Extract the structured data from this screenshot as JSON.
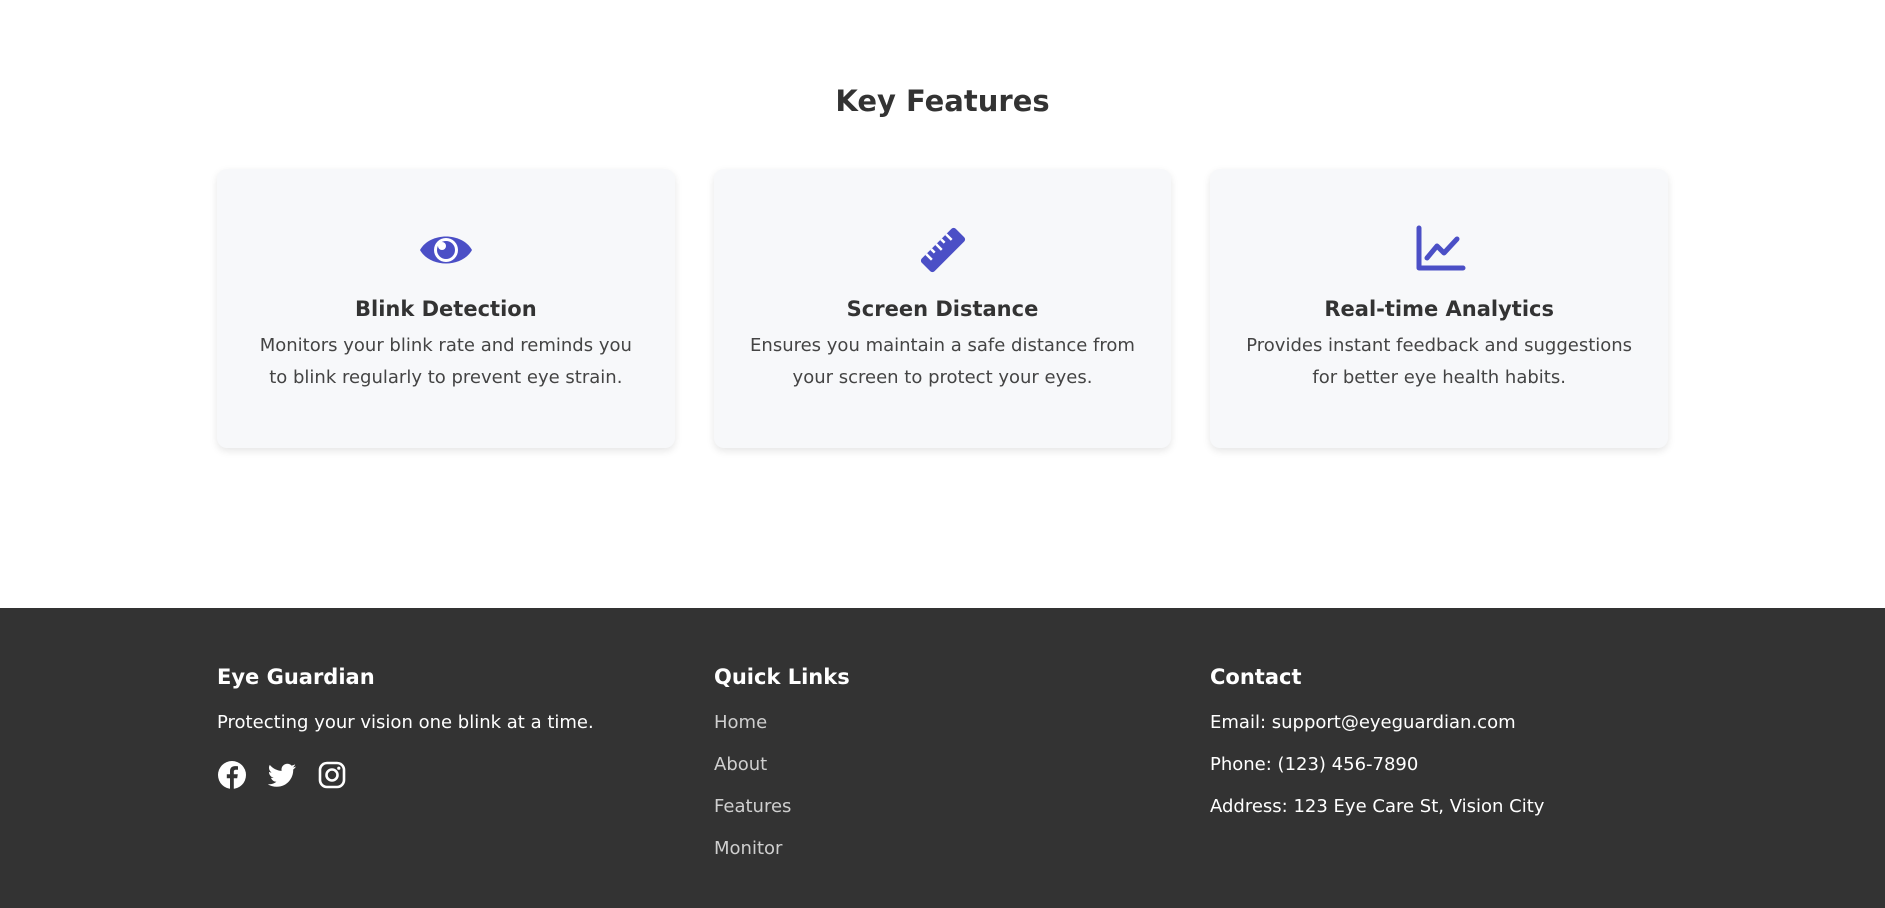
{
  "features": {
    "title": "Key Features",
    "accent_color": "#4b4fc6",
    "cards": [
      {
        "icon": "eye-icon",
        "title": "Blink Detection",
        "description": "Monitors your blink rate and reminds you to blink regularly to prevent eye strain."
      },
      {
        "icon": "ruler-icon",
        "title": "Screen Distance",
        "description": "Ensures you maintain a safe distance from your screen to protect your eyes."
      },
      {
        "icon": "chart-line-icon",
        "title": "Real-time Analytics",
        "description": "Provides instant feedback and suggestions for better eye health habits."
      }
    ]
  },
  "footer": {
    "background": "#333333",
    "brand": {
      "title": "Eye Guardian",
      "tagline": "Protecting your vision one blink at a time.",
      "socials": [
        "facebook-icon",
        "twitter-icon",
        "instagram-icon"
      ]
    },
    "quick_links": {
      "title": "Quick Links",
      "items": [
        "Home",
        "About",
        "Features",
        "Monitor"
      ]
    },
    "contact": {
      "title": "Contact",
      "email": "Email: support@eyeguardian.com",
      "phone": "Phone: (123) 456-7890",
      "address": "Address: 123 Eye Care St, Vision City"
    }
  }
}
